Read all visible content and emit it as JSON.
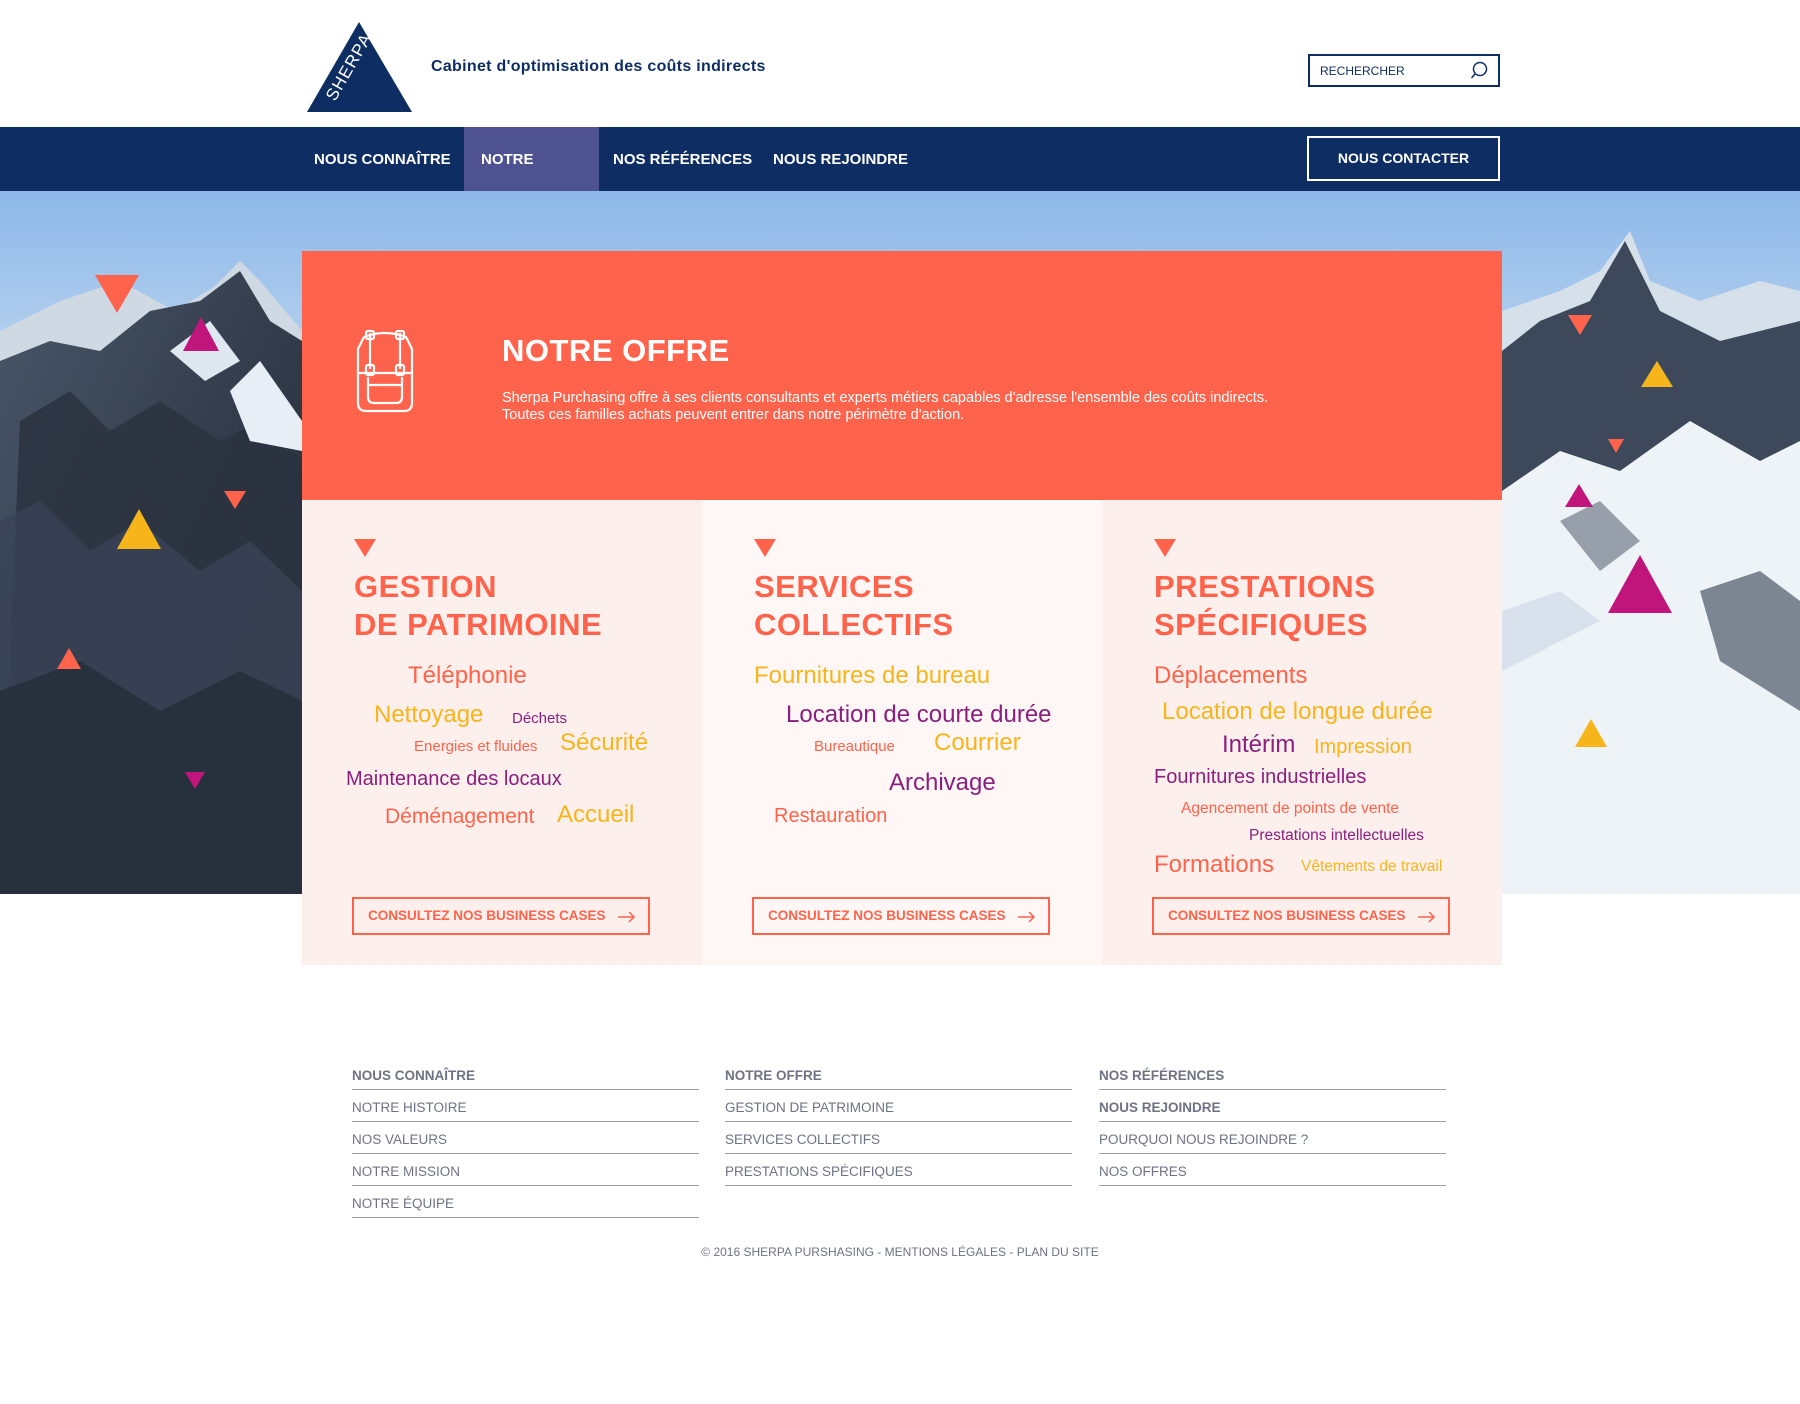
{
  "header": {
    "logo_text": "SHERPA",
    "tagline": "Cabinet d'optimisation des coûts indirects",
    "search_placeholder": "RECHERCHER"
  },
  "nav": {
    "items": [
      {
        "label": "NOUS CONNAÎTRE",
        "active": false
      },
      {
        "label": "NOTRE OFFRE",
        "active": true
      },
      {
        "label": "NOS RÉFÉRENCES",
        "active": false
      },
      {
        "label": "NOUS REJOINDRE",
        "active": false
      }
    ],
    "contact_label": "NOUS CONTACTER"
  },
  "offer": {
    "title": "NOTRE OFFRE",
    "desc_line1": "Sherpa Purchasing offre à ses clients consultants et experts métiers capables d'adresse l'ensemble des coûts indirects.",
    "desc_line2": "Toutes ces familles achats peuvent entrer dans notre périmètre d'action."
  },
  "columns": [
    {
      "title_line1": "GESTION",
      "title_line2": "DE PATRIMOINE",
      "keywords": [
        "Téléphonie",
        "Nettoyage",
        "Déchets",
        "Energies et fluides",
        "Sécurité",
        "Maintenance des locaux",
        "Déménagement",
        "Accueil"
      ],
      "button": "CONSULTEZ NOS BUSINESS CASES"
    },
    {
      "title_line1": "SERVICES",
      "title_line2": "COLLECTIFS",
      "keywords": [
        "Fournitures de bureau",
        "Location de courte durée",
        "Bureautique",
        "Courrier",
        "Archivage",
        "Restauration"
      ],
      "button": "CONSULTEZ NOS BUSINESS CASES"
    },
    {
      "title_line1": "PRESTATIONS",
      "title_line2": "SPÉCIFIQUES",
      "keywords": [
        "Déplacements",
        "Location de longue durée",
        "Intérim",
        "Impression",
        "Fournitures industrielles",
        "Agencement de points de vente",
        "Prestations intellectuelles",
        "Formations",
        "Vêtements de travail"
      ],
      "button": "CONSULTEZ NOS BUSINESS CASES"
    }
  ],
  "footer": {
    "col1": [
      "NOUS CONNAÎTRE",
      "NOTRE HISTOIRE",
      "NOS VALEURS",
      "NOTRE MISSION",
      "NOTRE ÉQUIPE"
    ],
    "col2": [
      "NOTRE OFFRE",
      "GESTION DE PATRIMOINE",
      "SERVICES COLLECTIFS",
      "PRESTATIONS SPÉCIFIQUES"
    ],
    "col3": [
      "NOS RÉFÉRENCES",
      "NOUS REJOINDRE",
      "POURQUOI NOUS REJOINDRE ?",
      "NOS OFFRES"
    ],
    "copyright": "© 2016 SHERPA PURSHASING",
    "sep": " - ",
    "legal": "MENTIONS LÉGALES",
    "sitemap": "PLAN DU SITE"
  },
  "colors": {
    "navy": "#0e2e63",
    "coral": "#ff634b",
    "yellow": "#f6b51b",
    "magenta": "#c0167b",
    "purple": "#8a1f7d",
    "nav_active": "#4e5290"
  },
  "icons": [
    "search-icon",
    "backpack-icon",
    "triangle-down-icon",
    "arrow-right-icon",
    "sherpa-logo"
  ]
}
